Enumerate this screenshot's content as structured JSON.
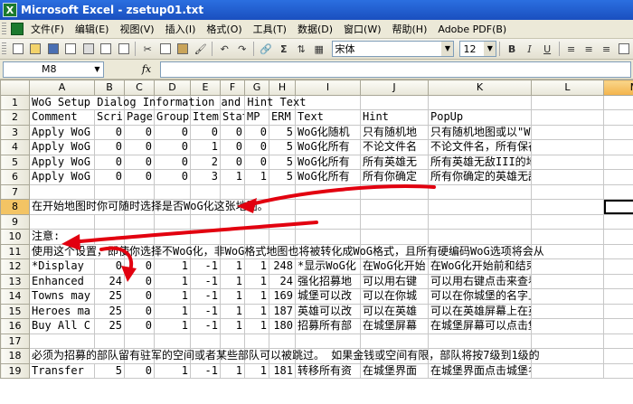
{
  "window": {
    "title": "Microsoft Excel - zsetup01.txt",
    "app_icon": "excel-icon"
  },
  "menu": [
    "文件(F)",
    "编辑(E)",
    "视图(V)",
    "插入(I)",
    "格式(O)",
    "工具(T)",
    "数据(D)",
    "窗口(W)",
    "帮助(H)",
    "Adobe PDF(B)"
  ],
  "toolbar": {
    "font": "宋体",
    "size": "12",
    "bold": "B",
    "italic": "I",
    "underline": "U"
  },
  "formula": {
    "cell": "M8",
    "fx": "fx",
    "content": ""
  },
  "columns": [
    "A",
    "B",
    "C",
    "D",
    "E",
    "F",
    "G",
    "H",
    "I",
    "J",
    "K",
    "L",
    "M"
  ],
  "selected_column": "M",
  "selected_row": "8",
  "rows": [
    {
      "n": "1",
      "cells": [
        {
          "c": "WoG Setup Dialog Information and Hint Text",
          "span": true
        }
      ]
    },
    {
      "n": "2",
      "cells": [
        "Comment",
        "Scri",
        "Page",
        "Group",
        "Item",
        "Stat",
        "MP",
        "ERM",
        "Text",
        "Hint",
        "PopUp"
      ]
    },
    {
      "n": "3",
      "cells": [
        "Apply WoG",
        "0",
        "0",
        "0",
        "0",
        "0",
        "0",
        "5",
        "WoG化随机",
        "只有随机地",
        "只有随机地图或以\"Wogify_\"开头的"
      ]
    },
    {
      "n": "4",
      "cells": [
        "Apply WoG",
        "0",
        "0",
        "0",
        "1",
        "0",
        "0",
        "5",
        "WoG化所有",
        "不论文件名",
        "不论文件名，所有保存为WoG格式的"
      ]
    },
    {
      "n": "5",
      "cells": [
        "Apply WoG",
        "0",
        "0",
        "0",
        "2",
        "0",
        "0",
        "5",
        "WoG化所有",
        "所有英雄无",
        "所有英雄无敌III的地图将被WoG化"
      ]
    },
    {
      "n": "6",
      "cells": [
        "Apply WoG",
        "0",
        "0",
        "0",
        "3",
        "1",
        "1",
        "5",
        "WoG化所有",
        "所有你确定",
        "所有你确定的英雄无敌III的地图将"
      ]
    },
    {
      "n": "7",
      "cells": []
    },
    {
      "n": "8",
      "cells": [
        {
          "c": "在开始地图时你可随时选择是否WoG化这张地图。",
          "span": true
        }
      ]
    },
    {
      "n": "9",
      "cells": []
    },
    {
      "n": "10",
      "cells": [
        "注意:"
      ]
    },
    {
      "n": "11",
      "cells": [
        {
          "c": "使用这个设置，即使你选择不WoG化，非WoG格式地图也将被转化成WoG格式，且所有硬编码WoG选项将会从",
          "span": true
        }
      ]
    },
    {
      "n": "12",
      "cells": [
        "*Display",
        "0",
        "0",
        "1",
        "-1",
        "1",
        "1",
        "248",
        "*显示WoG化",
        "在WoG化开始",
        "在WoG化开始前和结束后都将显示一"
      ]
    },
    {
      "n": "13",
      "cells": [
        "Enhanced",
        "24",
        "0",
        "1",
        "-1",
        "1",
        "1",
        "24",
        "强化招募地",
        "可以用右键",
        "可以用右键点击来查看己方（包括"
      ]
    },
    {
      "n": "14",
      "cells": [
        "Towns may",
        "25",
        "0",
        "1",
        "-1",
        "1",
        "1",
        "169",
        "城堡可以改",
        "可以在你城",
        "可以在你城堡的名字上点左键改变"
      ]
    },
    {
      "n": "15",
      "cells": [
        "Heroes ma",
        "25",
        "0",
        "1",
        "-1",
        "1",
        "1",
        "187",
        "英雄可以改",
        "可以在英雄",
        "可以在英雄屏幕上在英雄的名字上"
      ]
    },
    {
      "n": "16",
      "cells": [
        "Buy All C",
        "25",
        "0",
        "1",
        "-1",
        "1",
        "1",
        "180",
        "招募所有部",
        "在城堡屏幕",
        "在城堡屏幕可以点击堡垒图标（在"
      ]
    },
    {
      "n": "17",
      "cells": []
    },
    {
      "n": "18",
      "cells": [
        {
          "c": "必须为招募的部队留有驻军的空间或者某些部队可以被跳过。 如果金钱或空间有限，部队将按7级到1级的",
          "span": true
        }
      ]
    },
    {
      "n": "19",
      "cells": [
        "Transfer",
        "5",
        "0",
        "1",
        "-1",
        "1",
        "1",
        "181",
        "转移所有资",
        "在城堡界面",
        "在城堡界面点击城堡名字下面的金"
      ]
    }
  ]
}
